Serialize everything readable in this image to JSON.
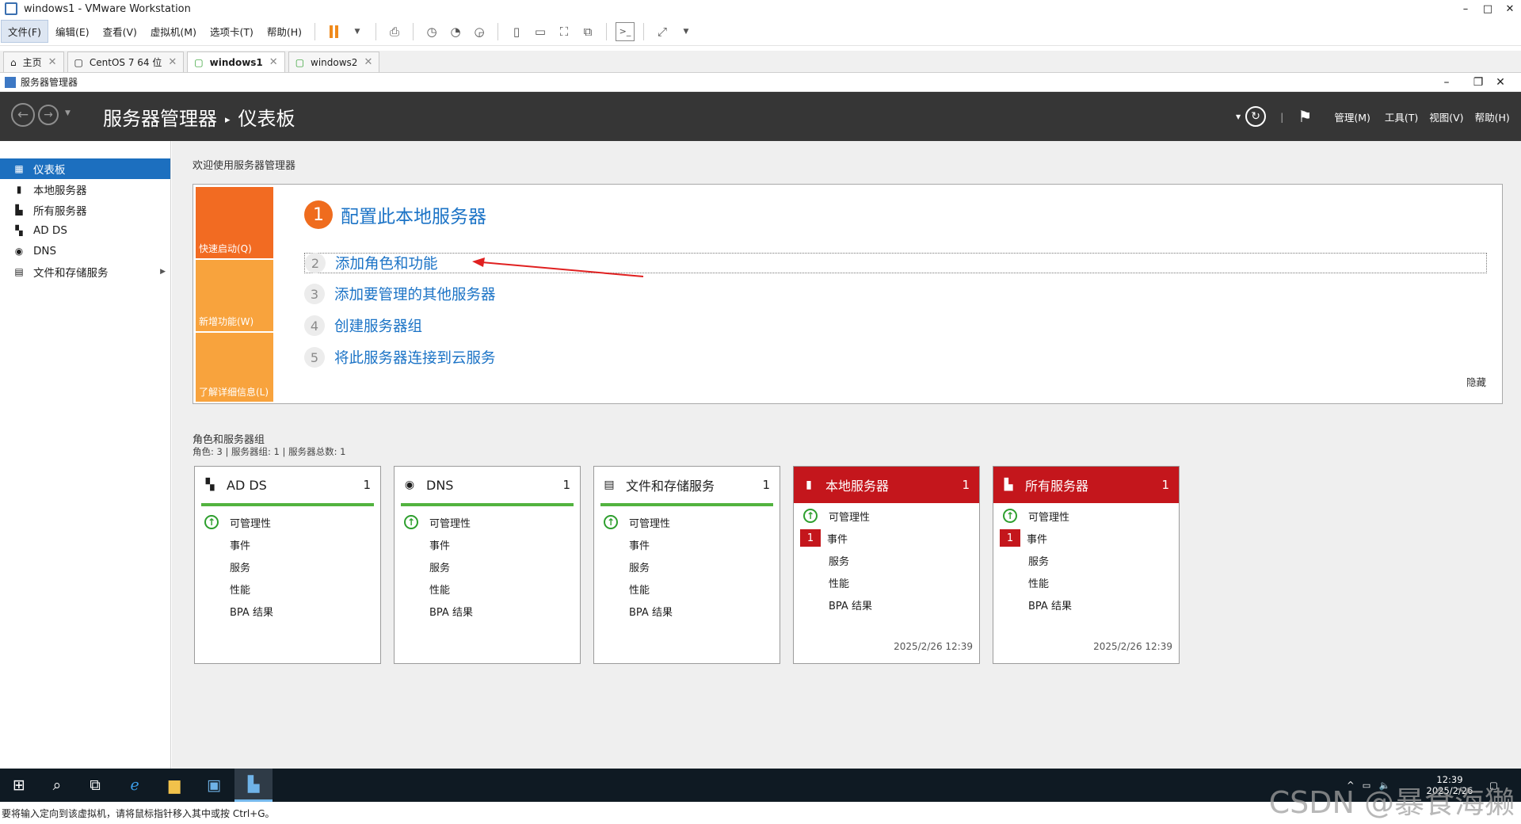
{
  "vmware": {
    "title": "windows1 - VMware Workstation",
    "window_controls": [
      "–",
      "□",
      "✕"
    ],
    "menus": [
      "文件(F)",
      "编辑(E)",
      "查看(V)",
      "虚拟机(M)",
      "选项卡(T)",
      "帮助(H)"
    ],
    "tabs": [
      {
        "label": "主页",
        "icon": "home-icon"
      },
      {
        "label": "CentOS 7 64 位",
        "icon": "vm-icon"
      },
      {
        "label": "windows1",
        "icon": "vm-running-icon",
        "active": true
      },
      {
        "label": "windows2",
        "icon": "vm-running-icon"
      }
    ],
    "status_text": "要将输入定向到该虚拟机，请将鼠标指针移入其中或按 Ctrl+G。"
  },
  "server_manager": {
    "window_title": "服务器管理器",
    "window_controls": [
      "–",
      "❐",
      "✕"
    ],
    "breadcrumb_root": "服务器管理器",
    "breadcrumb_sep": "▸",
    "breadcrumb_page": "仪表板",
    "header_menus": [
      "管理(M)",
      "工具(T)",
      "视图(V)",
      "帮助(H)"
    ],
    "nav": [
      {
        "label": "仪表板",
        "icon": "dashboard-icon",
        "active": true
      },
      {
        "label": "本地服务器",
        "icon": "server-icon"
      },
      {
        "label": "所有服务器",
        "icon": "servers-icon"
      },
      {
        "label": "AD DS",
        "icon": "adds-icon"
      },
      {
        "label": "DNS",
        "icon": "dns-icon"
      },
      {
        "label": "文件和存储服务",
        "icon": "storage-icon",
        "arrow": "▶"
      }
    ],
    "welcome_title": "欢迎使用服务器管理器",
    "quick_start": {
      "tiles": [
        {
          "label": "快速启动(Q)",
          "color": "#f26b22"
        },
        {
          "label": "新增功能(W)",
          "color": "#f8a33d"
        },
        {
          "label": "了解详细信息(L)",
          "color": "#f8a33d"
        }
      ],
      "step1_num": "1",
      "step1_label": "配置此本地服务器",
      "steps": [
        {
          "num": "2",
          "label": "添加角色和功能"
        },
        {
          "num": "3",
          "label": "添加要管理的其他服务器"
        },
        {
          "num": "4",
          "label": "创建服务器组"
        },
        {
          "num": "5",
          "label": "将此服务器连接到云服务"
        }
      ],
      "hide_label": "隐藏"
    },
    "roles_title": "角色和服务器组",
    "roles_subtitle": "角色: 3 | 服务器组: 1 | 服务器总数: 1",
    "cards": [
      {
        "title": "AD DS",
        "count": "1",
        "icon": "adds-icon",
        "style": "green",
        "rows": [
          "可管理性",
          "事件",
          "服务",
          "性能",
          "BPA 结果"
        ],
        "event_badge": "",
        "timestamp": ""
      },
      {
        "title": "DNS",
        "count": "1",
        "icon": "dns-icon",
        "style": "green",
        "rows": [
          "可管理性",
          "事件",
          "服务",
          "性能",
          "BPA 结果"
        ],
        "event_badge": "",
        "timestamp": ""
      },
      {
        "title": "文件和存储服务",
        "count": "1",
        "icon": "storage-icon",
        "style": "green",
        "rows": [
          "可管理性",
          "事件",
          "服务",
          "性能",
          "BPA 结果"
        ],
        "event_badge": "",
        "timestamp": ""
      },
      {
        "title": "本地服务器",
        "count": "1",
        "icon": "server-icon",
        "style": "red",
        "rows": [
          "可管理性",
          "事件",
          "服务",
          "性能",
          "BPA 结果"
        ],
        "event_badge": "1",
        "timestamp": "2025/2/26 12:39"
      },
      {
        "title": "所有服务器",
        "count": "1",
        "icon": "servers-icon",
        "style": "red",
        "rows": [
          "可管理性",
          "事件",
          "服务",
          "性能",
          "BPA 结果"
        ],
        "event_badge": "1",
        "timestamp": "2025/2/26 12:39"
      }
    ]
  },
  "taskbar": {
    "time": "12:39",
    "date": "2025/2/26"
  },
  "watermark": "CSDN @暴食海獭"
}
